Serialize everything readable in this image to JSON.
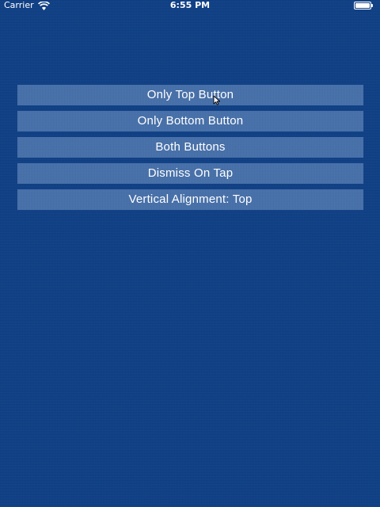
{
  "status_bar": {
    "carrier": "Carrier",
    "time": "6:55 PM",
    "icons": [
      "wifi-icon",
      "battery-icon"
    ]
  },
  "menu": {
    "buttons": [
      {
        "label": "Only Top Button"
      },
      {
        "label": "Only Bottom Button"
      },
      {
        "label": "Both Buttons"
      },
      {
        "label": "Dismiss On Tap"
      },
      {
        "label": "Vertical Alignment: Top"
      }
    ]
  },
  "colors": {
    "background": "#0e3f86",
    "button_fill": "#5f85bd",
    "text": "#ffffff"
  },
  "pointer": {
    "icon": "cursor-arrow-icon"
  }
}
